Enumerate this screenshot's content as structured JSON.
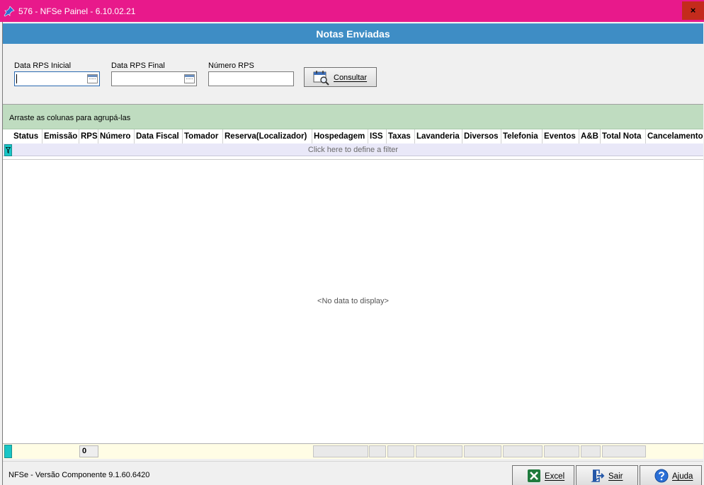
{
  "window": {
    "title": "576 - NFSe Painel - 6.10.02.21",
    "close_label": "×"
  },
  "header": {
    "title": "Notas Enviadas"
  },
  "filters": {
    "data_rps_inicial_label": "Data RPS Inicial",
    "data_rps_final_label": "Data RPS Final",
    "numero_rps_label": "Número RPS",
    "data_rps_inicial_value": "",
    "data_rps_final_value": "",
    "numero_rps_value": "",
    "consultar_label": "Consultar"
  },
  "grid": {
    "group_hint": "Arraste as colunas para agrupá-las",
    "columns": [
      "Status",
      "Emissão",
      "RPS",
      "Número",
      "Data Fiscal",
      "Tomador",
      "Reserva(Localizador)",
      "Hospedagem",
      "ISS",
      "Taxas",
      "Lavanderia",
      "Diversos",
      "Telefonia",
      "Eventos",
      "A&B",
      "Total Nota",
      "Cancelamento"
    ],
    "filter_hint": "Click here to define a filter",
    "empty_text": "<No data to display>",
    "footer_count": "0"
  },
  "status": {
    "version_text": "NFSe - Versão Componente 9.1.60.6420",
    "excel_label": "Excel",
    "sair_label": "Sair",
    "ajuda_label": "Ajuda"
  },
  "colors": {
    "titlebar": "#e8198b",
    "banner": "#3e8dc5",
    "groupbar": "#bfdcc0",
    "filterrow": "#e9e8f8",
    "footer": "#fffde5"
  }
}
